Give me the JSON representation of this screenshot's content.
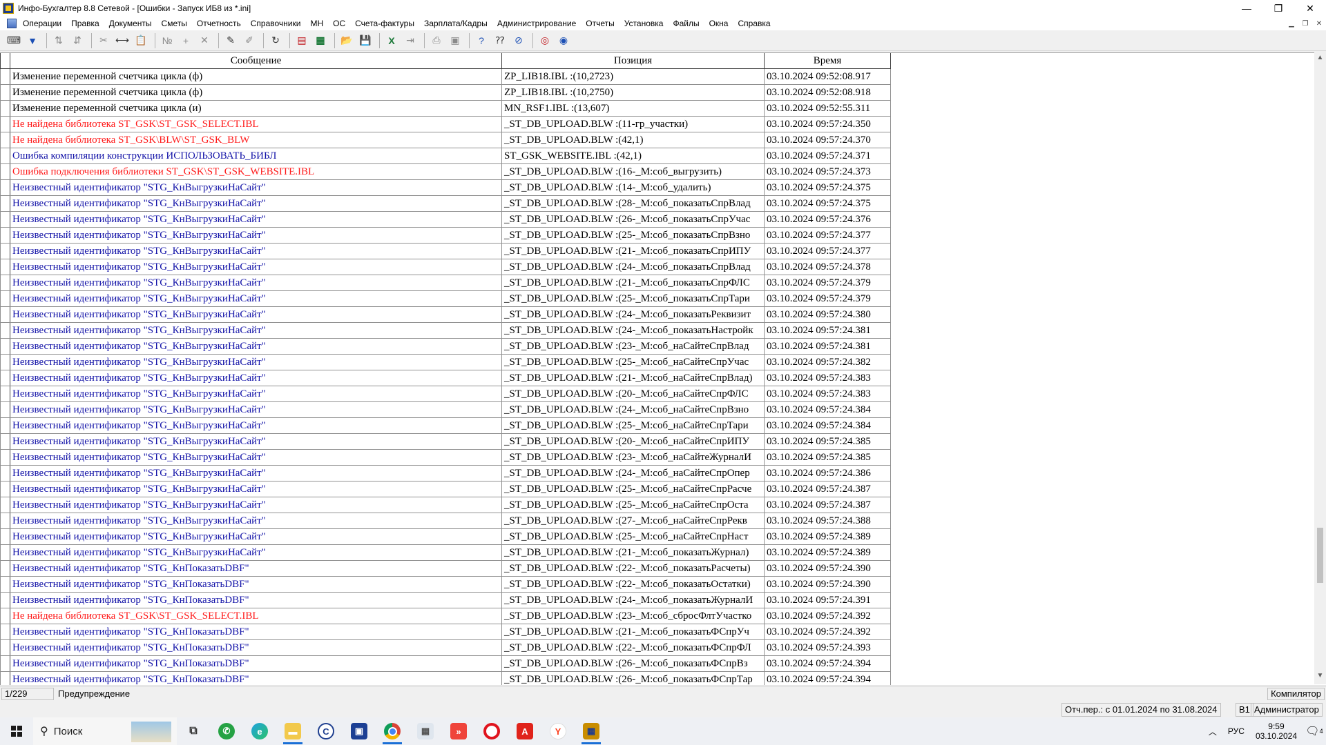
{
  "window": {
    "title": "Инфо-Бухгалтер 8.8 Сетевой - [Ошибки - Запуск ИБ8 из *.ini]",
    "minimize": "—",
    "maximize": "❐",
    "close": "✕"
  },
  "menu": [
    "Операции",
    "Правка",
    "Документы",
    "Сметы",
    "Отчетность",
    "Справочники",
    "МН",
    "ОС",
    "Счета-фактуры",
    "Зарплата/Кадры",
    "Администрирование",
    "Отчеты",
    "Установка",
    "Файлы",
    "Окна",
    "Справка"
  ],
  "grid": {
    "columns": [
      "Сообщение",
      "Позиция",
      "Время"
    ],
    "rows": [
      {
        "msg": "Изменение переменной счетчика цикла (ф)",
        "pos": "ZP_LIB18.IBL :(10,2723)",
        "time": "03.10.2024 09:52:08.917",
        "kind": "black"
      },
      {
        "msg": "Изменение переменной счетчика цикла (ф)",
        "pos": "ZP_LIB18.IBL :(10,2750)",
        "time": "03.10.2024 09:52:08.918",
        "kind": "black"
      },
      {
        "msg": "Изменение переменной счетчика цикла (и)",
        "pos": "MN_RSF1.IBL :(13,607)",
        "time": "03.10.2024 09:52:55.311",
        "kind": "black"
      },
      {
        "msg": "Не найдена библиотека ST_GSK\\ST_GSK_SELECT.IBL",
        "pos": "_ST_DB_UPLOAD.BLW :(11-гр_участки)",
        "time": "03.10.2024 09:57:24.350",
        "kind": "red"
      },
      {
        "msg": "Не найдена библиотека ST_GSK\\BLW\\ST_GSK_BLW",
        "pos": "_ST_DB_UPLOAD.BLW :(42,1)",
        "time": "03.10.2024 09:57:24.370",
        "kind": "red"
      },
      {
        "msg": "Ошибка компиляции конструкции ИСПОЛЬЗОВАТЬ_БИБЛ",
        "pos": "ST_GSK_WEBSITE.IBL :(42,1)",
        "time": "03.10.2024 09:57:24.371",
        "kind": "blue"
      },
      {
        "msg": "Ошибка подключения библиотеки ST_GSK\\ST_GSK_WEBSITE.IBL",
        "pos": "_ST_DB_UPLOAD.BLW :(16-_М:соб_выгрузить)",
        "time": "03.10.2024 09:57:24.373",
        "kind": "red"
      },
      {
        "msg": "Неизвестный идентификатор \"STG_КнВыгрузкиНаСайт\"",
        "pos": "_ST_DB_UPLOAD.BLW :(14-_М:соб_удалить)",
        "time": "03.10.2024 09:57:24.375",
        "kind": "blue"
      },
      {
        "msg": "Неизвестный идентификатор \"STG_КнВыгрузкиНаСайт\"",
        "pos": "_ST_DB_UPLOAD.BLW :(28-_М:соб_показатьСпрВлад",
        "time": "03.10.2024 09:57:24.375",
        "kind": "blue"
      },
      {
        "msg": "Неизвестный идентификатор \"STG_КнВыгрузкиНаСайт\"",
        "pos": "_ST_DB_UPLOAD.BLW :(26-_М:соб_показатьСпрУчас",
        "time": "03.10.2024 09:57:24.376",
        "kind": "blue"
      },
      {
        "msg": "Неизвестный идентификатор \"STG_КнВыгрузкиНаСайт\"",
        "pos": "_ST_DB_UPLOAD.BLW :(25-_М:соб_показатьСпрВзно",
        "time": "03.10.2024 09:57:24.377",
        "kind": "blue"
      },
      {
        "msg": "Неизвестный идентификатор \"STG_КнВыгрузкиНаСайт\"",
        "pos": "_ST_DB_UPLOAD.BLW :(21-_М:соб_показатьСпрИПУ",
        "time": "03.10.2024 09:57:24.377",
        "kind": "blue"
      },
      {
        "msg": "Неизвестный идентификатор \"STG_КнВыгрузкиНаСайт\"",
        "pos": "_ST_DB_UPLOAD.BLW :(24-_М:соб_показатьСпрВлад",
        "time": "03.10.2024 09:57:24.378",
        "kind": "blue"
      },
      {
        "msg": "Неизвестный идентификатор \"STG_КнВыгрузкиНаСайт\"",
        "pos": "_ST_DB_UPLOAD.BLW :(21-_М:соб_показатьСпрФЛС",
        "time": "03.10.2024 09:57:24.379",
        "kind": "blue"
      },
      {
        "msg": "Неизвестный идентификатор \"STG_КнВыгрузкиНаСайт\"",
        "pos": "_ST_DB_UPLOAD.BLW :(25-_М:соб_показатьСпрТари",
        "time": "03.10.2024 09:57:24.379",
        "kind": "blue"
      },
      {
        "msg": "Неизвестный идентификатор \"STG_КнВыгрузкиНаСайт\"",
        "pos": "_ST_DB_UPLOAD.BLW :(24-_М:соб_показатьРеквизит",
        "time": "03.10.2024 09:57:24.380",
        "kind": "blue"
      },
      {
        "msg": "Неизвестный идентификатор \"STG_КнВыгрузкиНаСайт\"",
        "pos": "_ST_DB_UPLOAD.BLW :(24-_М:соб_показатьНастройк",
        "time": "03.10.2024 09:57:24.381",
        "kind": "blue"
      },
      {
        "msg": "Неизвестный идентификатор \"STG_КнВыгрузкиНаСайт\"",
        "pos": "_ST_DB_UPLOAD.BLW :(23-_М:соб_наСайтеСпрВлад",
        "time": "03.10.2024 09:57:24.381",
        "kind": "blue"
      },
      {
        "msg": "Неизвестный идентификатор \"STG_КнВыгрузкиНаСайт\"",
        "pos": "_ST_DB_UPLOAD.BLW :(25-_М:соб_наСайтеСпрУчас",
        "time": "03.10.2024 09:57:24.382",
        "kind": "blue"
      },
      {
        "msg": "Неизвестный идентификатор \"STG_КнВыгрузкиНаСайт\"",
        "pos": "_ST_DB_UPLOAD.BLW :(21-_М:соб_наСайтеСпрВлад)",
        "time": "03.10.2024 09:57:24.383",
        "kind": "blue"
      },
      {
        "msg": "Неизвестный идентификатор \"STG_КнВыгрузкиНаСайт\"",
        "pos": "_ST_DB_UPLOAD.BLW :(20-_М:соб_наСайтеСпрФЛС",
        "time": "03.10.2024 09:57:24.383",
        "kind": "blue"
      },
      {
        "msg": "Неизвестный идентификатор \"STG_КнВыгрузкиНаСайт\"",
        "pos": "_ST_DB_UPLOAD.BLW :(24-_М:соб_наСайтеСпрВзно",
        "time": "03.10.2024 09:57:24.384",
        "kind": "blue"
      },
      {
        "msg": "Неизвестный идентификатор \"STG_КнВыгрузкиНаСайт\"",
        "pos": "_ST_DB_UPLOAD.BLW :(25-_М:соб_наСайтеСпрТари",
        "time": "03.10.2024 09:57:24.384",
        "kind": "blue"
      },
      {
        "msg": "Неизвестный идентификатор \"STG_КнВыгрузкиНаСайт\"",
        "pos": "_ST_DB_UPLOAD.BLW :(20-_М:соб_наСайтеСпрИПУ",
        "time": "03.10.2024 09:57:24.385",
        "kind": "blue"
      },
      {
        "msg": "Неизвестный идентификатор \"STG_КнВыгрузкиНаСайт\"",
        "pos": "_ST_DB_UPLOAD.BLW :(23-_М:соб_наСайтеЖурналИ",
        "time": "03.10.2024 09:57:24.385",
        "kind": "blue"
      },
      {
        "msg": "Неизвестный идентификатор \"STG_КнВыгрузкиНаСайт\"",
        "pos": "_ST_DB_UPLOAD.BLW :(24-_М:соб_наСайтеСпрОпер",
        "time": "03.10.2024 09:57:24.386",
        "kind": "blue"
      },
      {
        "msg": "Неизвестный идентификатор \"STG_КнВыгрузкиНаСайт\"",
        "pos": "_ST_DB_UPLOAD.BLW :(25-_М:соб_наСайтеСпрРасче",
        "time": "03.10.2024 09:57:24.387",
        "kind": "blue"
      },
      {
        "msg": "Неизвестный идентификатор \"STG_КнВыгрузкиНаСайт\"",
        "pos": "_ST_DB_UPLOAD.BLW :(25-_М:соб_наСайтеСпрОста",
        "time": "03.10.2024 09:57:24.387",
        "kind": "blue"
      },
      {
        "msg": "Неизвестный идентификатор \"STG_КнВыгрузкиНаСайт\"",
        "pos": "_ST_DB_UPLOAD.BLW :(27-_М:соб_наСайтеСпрРекв",
        "time": "03.10.2024 09:57:24.388",
        "kind": "blue"
      },
      {
        "msg": "Неизвестный идентификатор \"STG_КнВыгрузкиНаСайт\"",
        "pos": "_ST_DB_UPLOAD.BLW :(25-_М:соб_наСайтеСпрНаст",
        "time": "03.10.2024 09:57:24.389",
        "kind": "blue"
      },
      {
        "msg": "Неизвестный идентификатор \"STG_КнВыгрузкиНаСайт\"",
        "pos": "_ST_DB_UPLOAD.BLW :(21-_М:соб_показатьЖурнал)",
        "time": "03.10.2024 09:57:24.389",
        "kind": "blue"
      },
      {
        "msg": "Неизвестный идентификатор \"STG_КнПоказатьDBF\"",
        "pos": "_ST_DB_UPLOAD.BLW :(22-_М:соб_показатьРасчеты)",
        "time": "03.10.2024 09:57:24.390",
        "kind": "blue"
      },
      {
        "msg": "Неизвестный идентификатор \"STG_КнПоказатьDBF\"",
        "pos": "_ST_DB_UPLOAD.BLW :(22-_М:соб_показатьОстатки)",
        "time": "03.10.2024 09:57:24.390",
        "kind": "blue"
      },
      {
        "msg": "Неизвестный идентификатор \"STG_КнПоказатьDBF\"",
        "pos": "_ST_DB_UPLOAD.BLW :(24-_М:соб_показатьЖурналИ",
        "time": "03.10.2024 09:57:24.391",
        "kind": "blue"
      },
      {
        "msg": "Не найдена библиотека ST_GSK\\ST_GSK_SELECT.IBL",
        "pos": "_ST_DB_UPLOAD.BLW :(23-_М:соб_сбросФлтУчастко",
        "time": "03.10.2024 09:57:24.392",
        "kind": "red"
      },
      {
        "msg": "Неизвестный идентификатор \"STG_КнПоказатьDBF\"",
        "pos": "_ST_DB_UPLOAD.BLW :(21-_М:соб_показатьФСпрУч",
        "time": "03.10.2024 09:57:24.392",
        "kind": "blue"
      },
      {
        "msg": "Неизвестный идентификатор \"STG_КнПоказатьDBF\"",
        "pos": "_ST_DB_UPLOAD.BLW :(22-_М:соб_показатьФСпрФЛ",
        "time": "03.10.2024 09:57:24.393",
        "kind": "blue"
      },
      {
        "msg": "Неизвестный идентификатор \"STG_КнПоказатьDBF\"",
        "pos": "_ST_DB_UPLOAD.BLW :(26-_М:соб_показатьФСпрВз",
        "time": "03.10.2024 09:57:24.394",
        "kind": "blue"
      },
      {
        "msg": "Неизвестный идентификатор \"STG_КнПоказатьDBF\"",
        "pos": "_ST_DB_UPLOAD.BLW :(26-_М:соб_показатьФСпрТар",
        "time": "03.10.2024 09:57:24.394",
        "kind": "blue"
      }
    ]
  },
  "status": {
    "record_counter": "1/229",
    "message_type": "Предупреждение",
    "mode": "Компилятор"
  },
  "status2": {
    "period": "Отч.пер.: с 01.01.2024 по 31.08.2024",
    "version": "В1",
    "user": "Администратор"
  },
  "taskbar": {
    "search_label": "Поиск",
    "lang": "РУС",
    "time": "9:59",
    "date": "03.10.2024",
    "notifications": "4"
  },
  "colors": {
    "msg_red": "#ff1a1a",
    "msg_blue": "#1414a8",
    "taskbar_accent": "#1a6fd6"
  }
}
